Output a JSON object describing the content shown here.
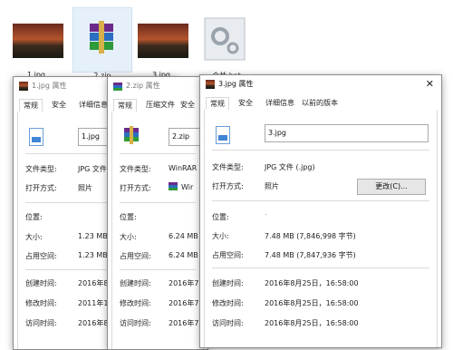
{
  "desktop": {
    "files": [
      {
        "label": "1.jpg",
        "icon": "image-thumbnail"
      },
      {
        "label": "2.zip",
        "icon": "winrar-archive-icon"
      },
      {
        "label": "3.jpg",
        "icon": "image-thumbnail"
      },
      {
        "label": "合并.bat",
        "icon": "gear-batch-icon"
      }
    ]
  },
  "dialog1": {
    "title": "1.jpg 属性",
    "tabs": [
      "常规",
      "安全",
      "详细信息"
    ],
    "filename": "1.jpg",
    "rows": {
      "type_label": "文件类型:",
      "type_value": "JPG 文件",
      "open_label": "打开方式:",
      "open_value": "照片",
      "loc_label": "位置:",
      "loc_value": "",
      "size_label": "大小:",
      "size_value": "1.23 MB",
      "disk_label": "占用空间:",
      "disk_value": "1.23 MB",
      "created_label": "创建时间:",
      "created_value": "2016年8",
      "modified_label": "修改时间:",
      "modified_value": "2011年10",
      "accessed_label": "访问时间:",
      "accessed_value": "2016年8"
    }
  },
  "dialog2": {
    "title": "2.zip 属性",
    "tabs": [
      "常规",
      "压缩文件",
      "安全"
    ],
    "filename": "2.zip",
    "rows": {
      "type_label": "文件类型:",
      "type_value": "WinRAR",
      "open_label": "打开方式:",
      "open_value": "Wir",
      "loc_label": "位置:",
      "size_label": "大小:",
      "size_value": "6.24 MB",
      "disk_label": "占用空间:",
      "disk_value": "6.24 MB",
      "created_label": "创建时间:",
      "created_value": "2016年7",
      "modified_label": "修改时间:",
      "modified_value": "2016年7",
      "accessed_label": "访问时间:",
      "accessed_value": "2016年7"
    }
  },
  "dialog3": {
    "title": "3.jpg 属性",
    "close": "✕",
    "tabs": [
      "常规",
      "安全",
      "详细信息",
      "以前的版本"
    ],
    "filename": "3.jpg",
    "change_button": "更改(C)...",
    "rows": {
      "type_label": "文件类型:",
      "type_value": "JPG 文件 (.jpg)",
      "open_label": "打开方式:",
      "open_value": "照片",
      "loc_label": "位置:",
      "loc_value": ".",
      "size_label": "大小:",
      "size_value": "7.48 MB (7,846,998 字节)",
      "disk_label": "占用空间:",
      "disk_value": "7.48 MB (7,847,936 字节)",
      "created_label": "创建时间:",
      "created_value": "2016年8月25日，16:58:00",
      "modified_label": "修改时间:",
      "modified_value": "2016年8月25日，16:58:00",
      "accessed_label": "访问时间:",
      "accessed_value": "2016年8月25日，16:58:00"
    }
  }
}
